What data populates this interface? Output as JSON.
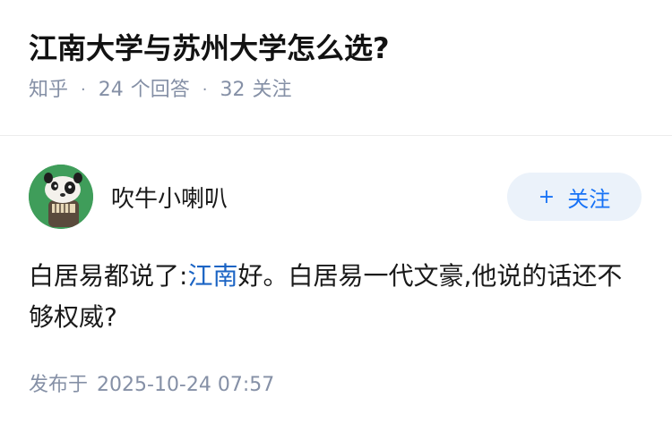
{
  "question": {
    "title": "江南大学与苏州大学怎么选?",
    "source": "知乎",
    "separator": "·",
    "answer_count": "24",
    "answer_label": "个回答",
    "follower_count": "32",
    "follower_label": "关注"
  },
  "answer": {
    "author_name": "吹牛小喇叭",
    "follow_plus": "+",
    "follow_label": "关注",
    "content_before": "白居易都说了:",
    "content_link": "江南",
    "content_after": "好。白居易一代文豪,他说的话还不够权威?",
    "publish_label": "发布于",
    "publish_time": "2025-10-24 07:57"
  },
  "colors": {
    "link": "#1b64c4",
    "follow_text": "#1772f6",
    "follow_bg": "#ebf2fa",
    "meta": "#8590a6",
    "avatar_bg": "#3f9d5a"
  }
}
